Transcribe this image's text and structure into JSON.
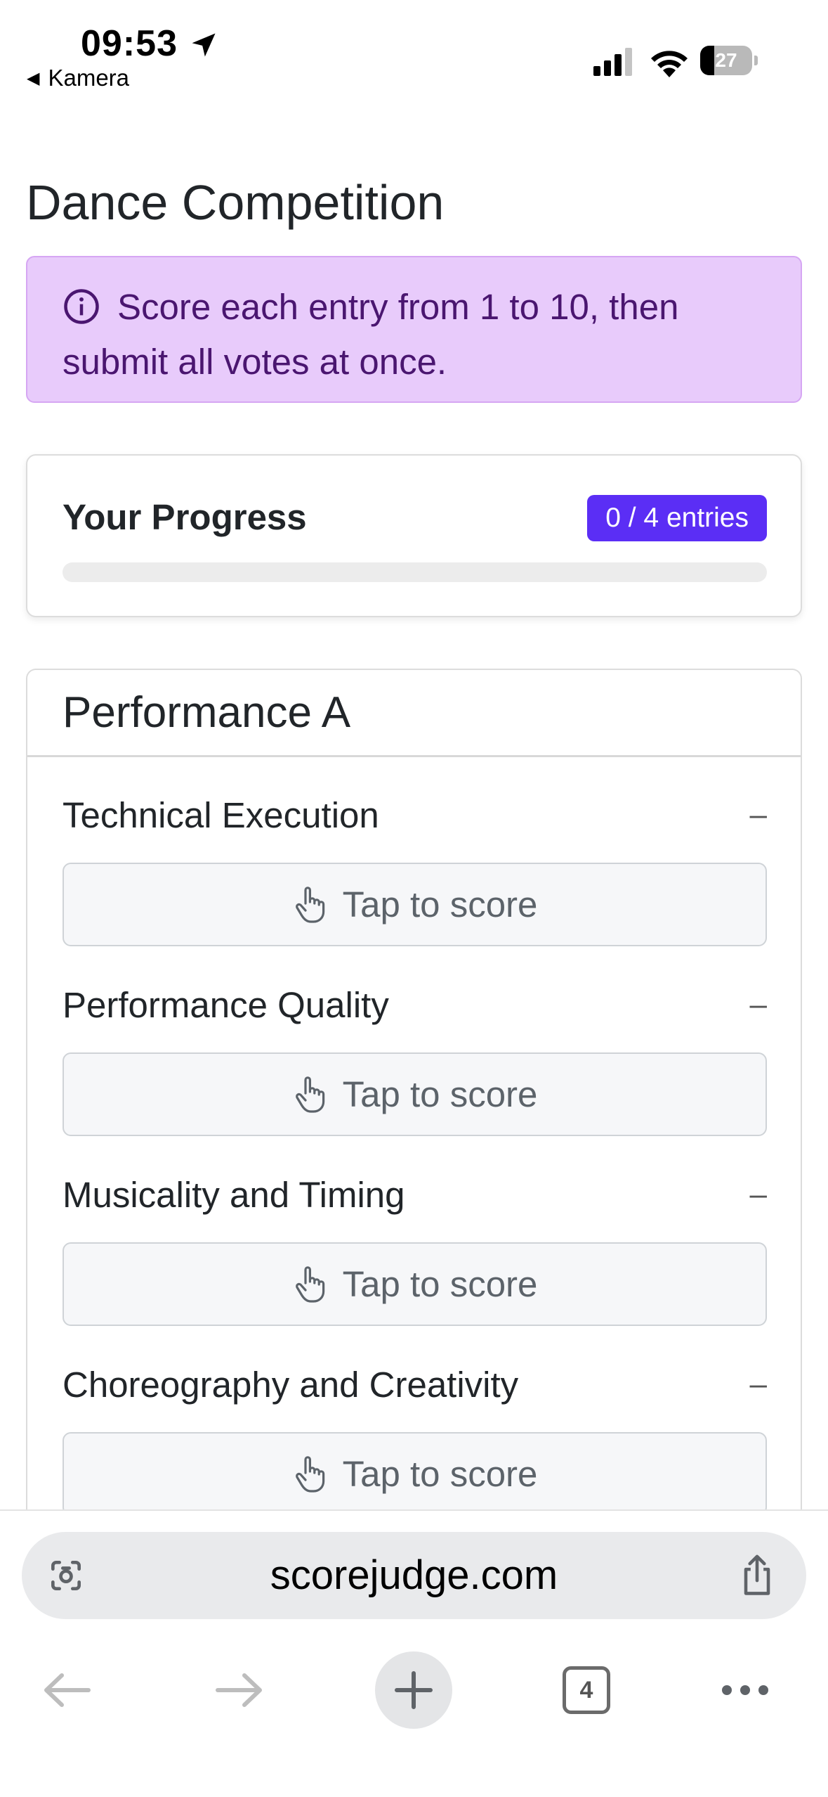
{
  "status_bar": {
    "time": "09:53",
    "back_app": "Kamera",
    "battery_percent": 27
  },
  "page": {
    "title": "Dance Competition",
    "info_text": "Score each entry from 1 to 10, then submit all votes at once."
  },
  "progress": {
    "title": "Your Progress",
    "badge": "0 / 4 entries",
    "completed": 0,
    "total": 4
  },
  "performance": {
    "title": "Performance A",
    "criteria": [
      {
        "label": "Technical Execution",
        "value": "–",
        "button": "Tap to score"
      },
      {
        "label": "Performance Quality",
        "value": "–",
        "button": "Tap to score"
      },
      {
        "label": "Musicality and Timing",
        "value": "–",
        "button": "Tap to score"
      },
      {
        "label": "Choreography and Creativity",
        "value": "–",
        "button": "Tap to score"
      }
    ]
  },
  "browser": {
    "url": "scorejudge.com",
    "tab_count": "4"
  },
  "colors": {
    "accent": "#5b2ef5",
    "alert_bg": "#e8cbfb",
    "alert_text": "#4a1670"
  }
}
